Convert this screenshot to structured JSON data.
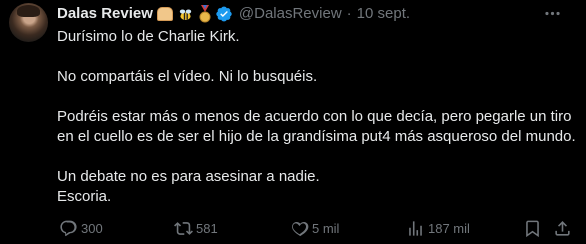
{
  "author": {
    "name": "Dalas Review",
    "handle": "@DalasReview",
    "separator": "·",
    "date": "10 sept."
  },
  "badge_icons": [
    "bread-emoji-icon",
    "bee-emoji-icon",
    "medal-emoji-icon",
    "verified-badge-icon"
  ],
  "tweet": {
    "line1": "Durísimo lo de Charlie Kirk.",
    "line2": "No compartáis el vídeo. Ni lo busquéis.",
    "line3": "Podréis estar más o menos de acuerdo con lo que decía, pero pegarle un tiro",
    "line4": "en el cuello es de ser el hijo de la grandísima put4 más asqueroso del mundo.",
    "line5": "Un debate no es para asesinar a nadie.",
    "line6": "Escoria."
  },
  "actions": {
    "replies": "300",
    "reposts": "581",
    "likes": "5 mil",
    "views": "187 mil"
  },
  "colors": {
    "background": "#000000",
    "text": "#e7e9ea",
    "muted": "#71767b",
    "verified": "#1d9bf0"
  }
}
